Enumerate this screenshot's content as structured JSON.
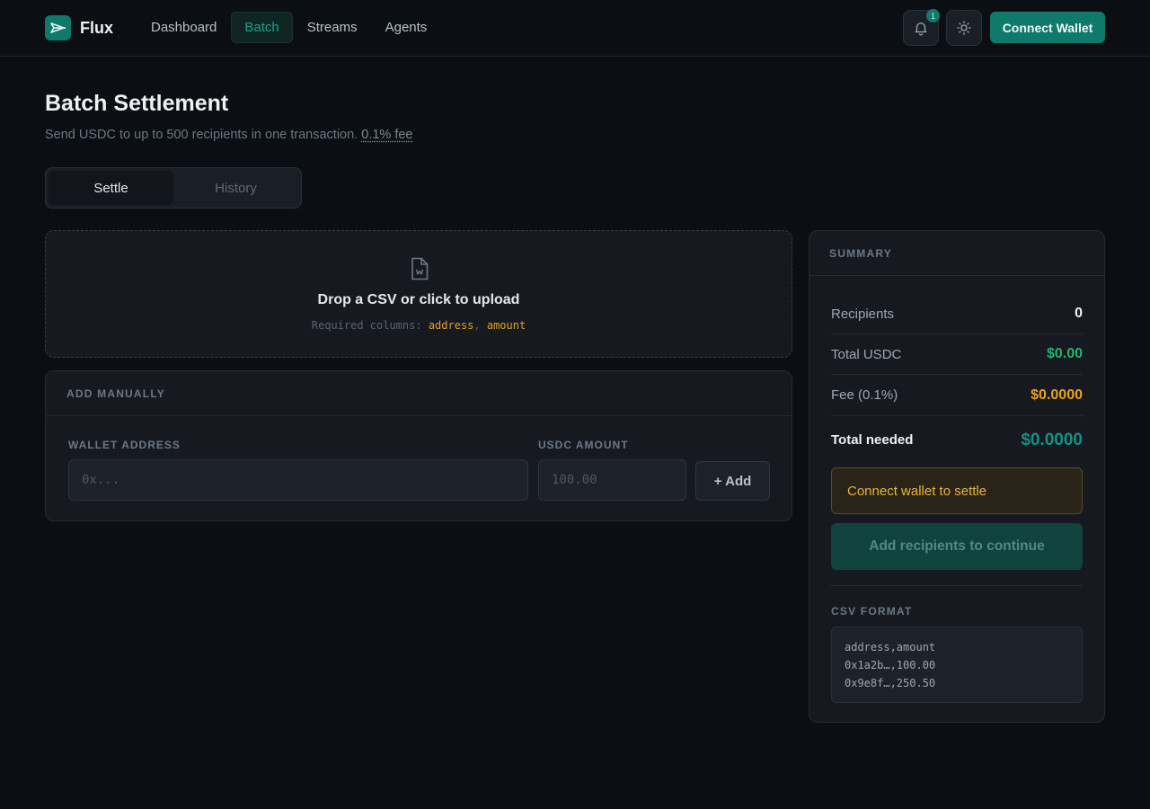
{
  "app": {
    "brand": "Flux",
    "nav": [
      {
        "label": "Dashboard",
        "active": false
      },
      {
        "label": "Batch",
        "active": true
      },
      {
        "label": "Streams",
        "active": false
      },
      {
        "label": "Agents",
        "active": false
      }
    ],
    "notification_count": "1",
    "connect_wallet_label": "Connect Wallet"
  },
  "page": {
    "title": "Batch Settlement",
    "subtitle": "Send USDC to up to 500 recipients in one transaction.",
    "fee_link": "0.1% fee",
    "tabs": [
      {
        "label": "Settle",
        "active": true
      },
      {
        "label": "History",
        "active": false
      }
    ]
  },
  "upload": {
    "title": "Drop a CSV or click to upload",
    "required_prefix": "Required columns:",
    "col_address": "address",
    "col_amount": "amount"
  },
  "manual": {
    "heading": "ADD MANUALLY",
    "wallet_label": "WALLET ADDRESS",
    "wallet_placeholder": "0x...",
    "amount_label": "USDC AMOUNT",
    "amount_placeholder": "100.00",
    "add_label": "+ Add"
  },
  "summary": {
    "heading": "SUMMARY",
    "rows": [
      {
        "label": "Recipients",
        "value": "0",
        "color": "#eef0f2"
      },
      {
        "label": "Total USDC",
        "value": "$0.00",
        "color": "#22b36b"
      },
      {
        "label": "Fee (0.1%)",
        "value": "$0.0000",
        "color": "#e9a21d"
      }
    ],
    "total_label": "Total needed",
    "total_value": "$0.0000",
    "warning": "Connect wallet to settle",
    "continue_label": "Add recipients to continue",
    "csv_heading": "CSV FORMAT",
    "csv_lines": [
      "address,amount",
      "0x1a2b…,100.00",
      "0x9e8f…,250.50"
    ]
  }
}
